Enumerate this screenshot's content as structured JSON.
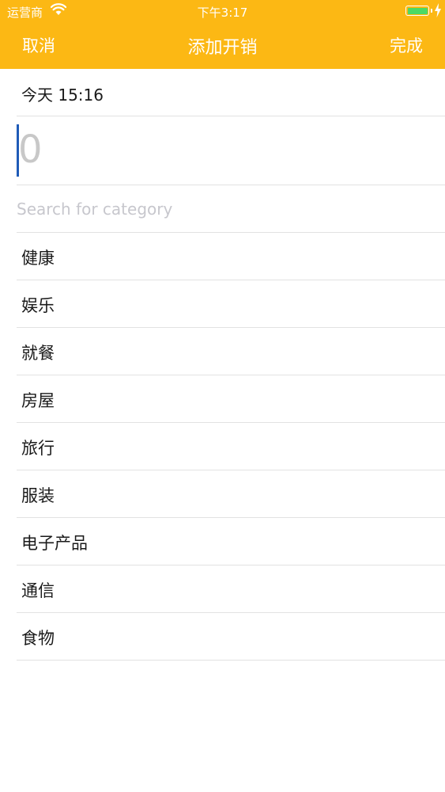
{
  "status_bar": {
    "carrier": "运营商",
    "time": "下午3:17",
    "battery_color": "#4cd964",
    "wifi_icon": "wifi-icon",
    "charging_icon": "lightning-icon"
  },
  "nav": {
    "cancel_label": "取消",
    "title": "添加开销",
    "done_label": "完成",
    "background_color": "#fcb814"
  },
  "date": {
    "label": "今天 15:16"
  },
  "amount": {
    "value": "",
    "placeholder": "0"
  },
  "search": {
    "value": "",
    "placeholder": "Search for category"
  },
  "categories": [
    {
      "label": "健康"
    },
    {
      "label": "娱乐"
    },
    {
      "label": "就餐"
    },
    {
      "label": "房屋"
    },
    {
      "label": "旅行"
    },
    {
      "label": "服装"
    },
    {
      "label": "电子产品"
    },
    {
      "label": "通信"
    },
    {
      "label": "食物"
    }
  ]
}
